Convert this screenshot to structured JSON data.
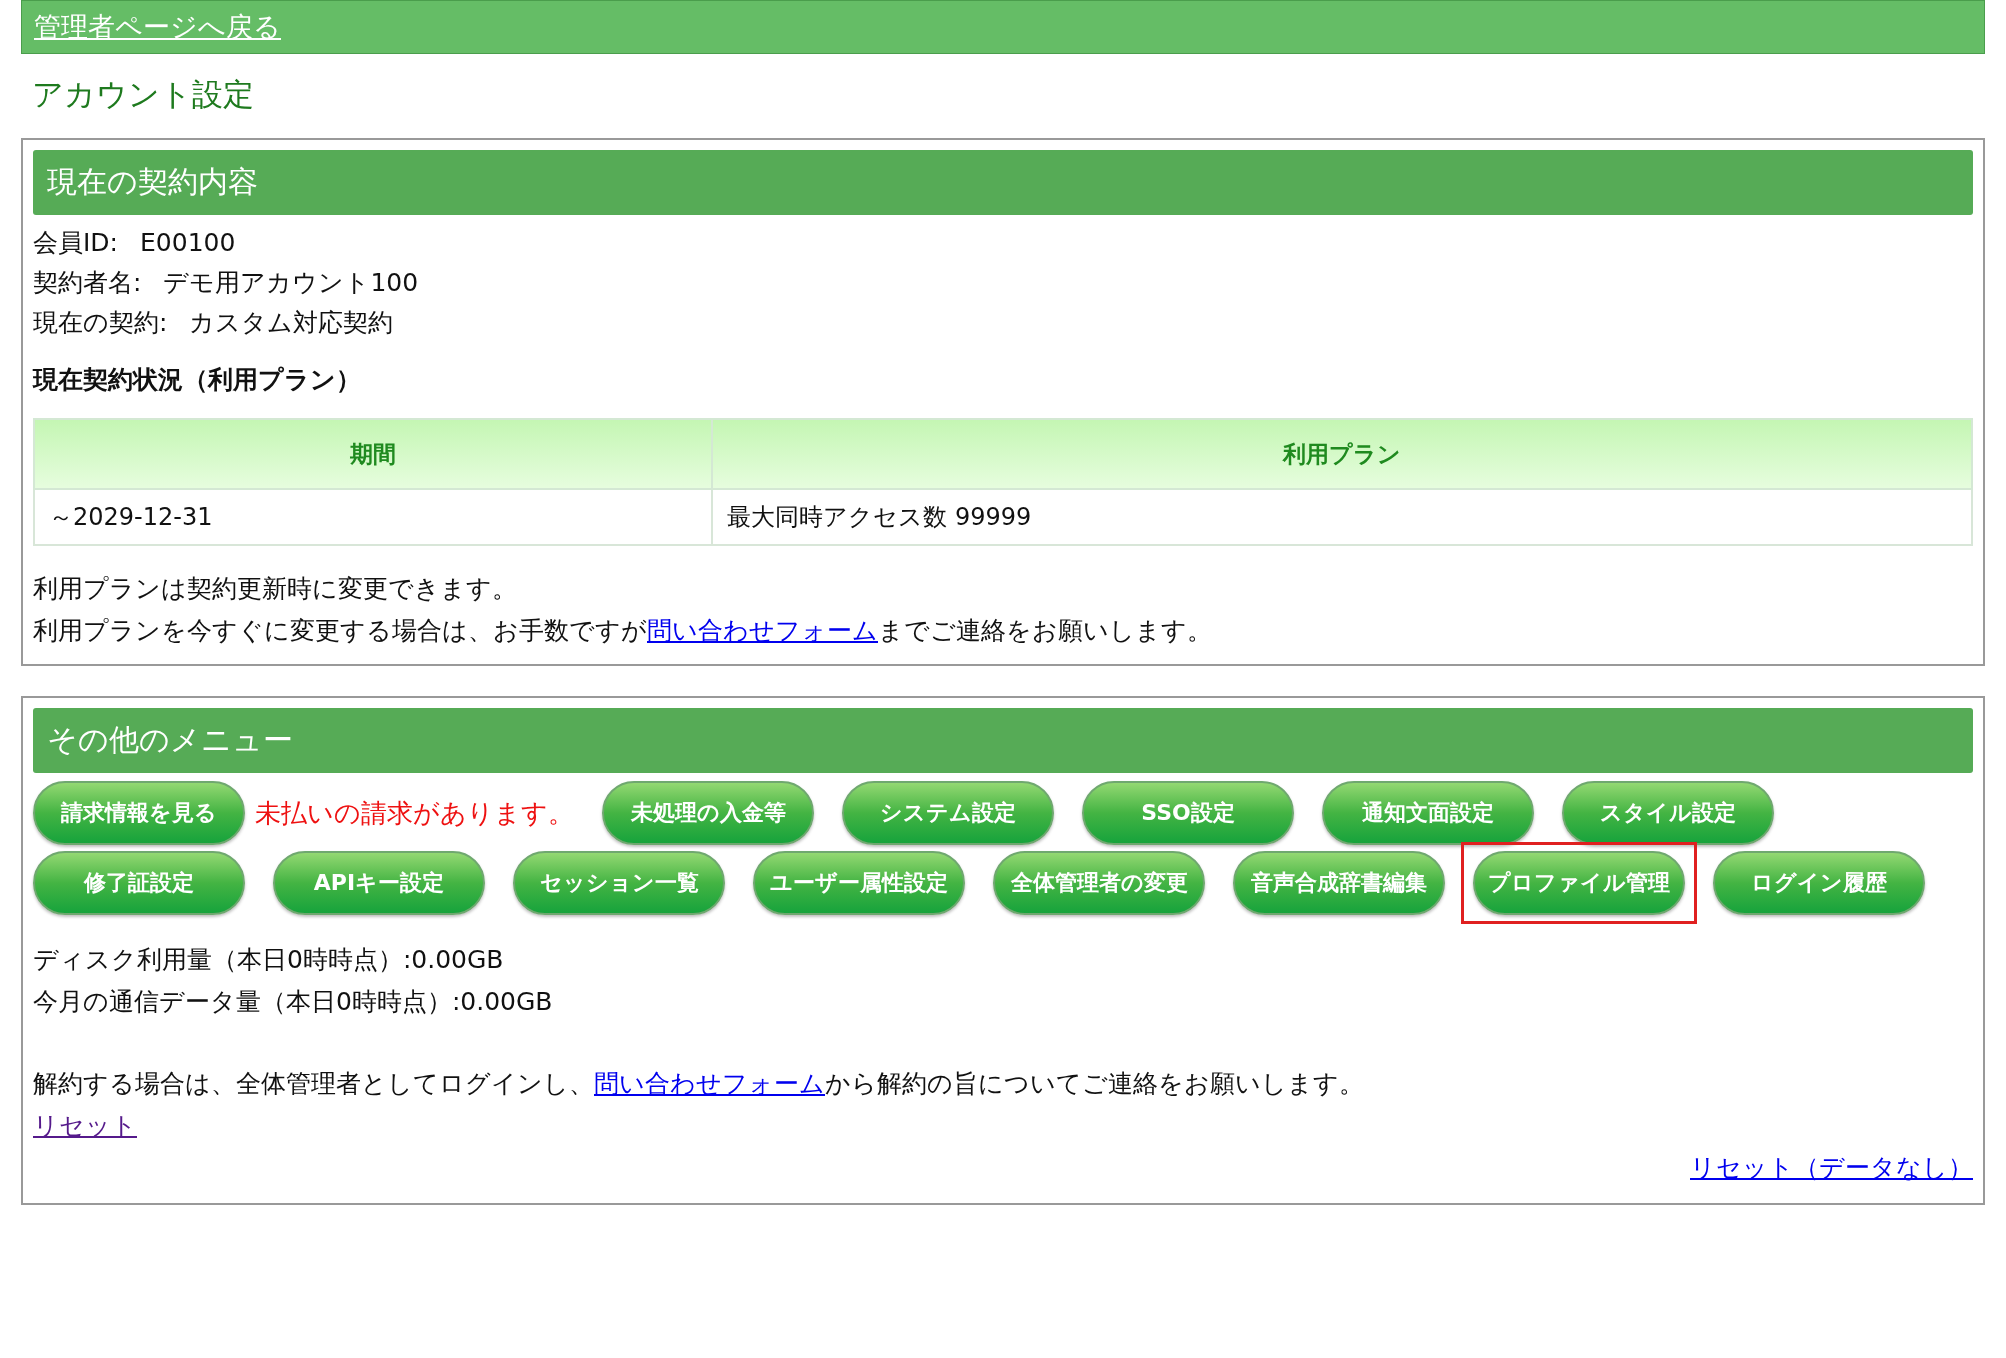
{
  "top_bar": {
    "back_link": "管理者ページへ戻る"
  },
  "page_title": "アカウント設定",
  "contract_panel": {
    "heading": "現在の契約内容",
    "fields": [
      {
        "label": "会員ID:",
        "value": "E00100"
      },
      {
        "label": "契約者名:",
        "value": "デモ用アカウント100"
      },
      {
        "label": "現在の契約:",
        "value": "カスタム対応契約"
      }
    ],
    "status_heading": "現在契約状況（利用プラン）",
    "table": {
      "columns": [
        "期間",
        "利用プラン"
      ],
      "rows": [
        [
          "～2029-12-31",
          "最大同時アクセス数 99999"
        ]
      ]
    },
    "note": "利用プランは契約更新時に変更できます。",
    "change_note": {
      "before": "利用プランを今すぐに変更する場合は、お手数ですが",
      "link": "問い合わせフォーム",
      "after": "までご連絡をお願いします。"
    }
  },
  "menu_panel": {
    "heading": "その他のメニュー",
    "items": [
      {
        "kind": "button",
        "label": "請求情報を見る",
        "highlighted": false
      },
      {
        "kind": "notice",
        "label": "未払いの請求があります。"
      },
      {
        "kind": "button",
        "label": "未処理の入金等",
        "highlighted": false
      },
      {
        "kind": "button",
        "label": "システム設定",
        "highlighted": false
      },
      {
        "kind": "button",
        "label": "SSO設定",
        "highlighted": false
      },
      {
        "kind": "button",
        "label": "通知文面設定",
        "highlighted": false
      },
      {
        "kind": "button",
        "label": "スタイル設定",
        "highlighted": false
      },
      {
        "kind": "button",
        "label": "修了証設定",
        "highlighted": false
      },
      {
        "kind": "button",
        "label": "APIキー設定",
        "highlighted": false
      },
      {
        "kind": "button",
        "label": "セッション一覧",
        "highlighted": false
      },
      {
        "kind": "button",
        "label": "ユーザー属性設定",
        "highlighted": false
      },
      {
        "kind": "button",
        "label": "全体管理者の変更",
        "highlighted": false
      },
      {
        "kind": "button",
        "label": "音声合成辞書編集",
        "highlighted": false
      },
      {
        "kind": "button",
        "label": "プロファイル管理",
        "highlighted": true
      },
      {
        "kind": "button",
        "label": "ログイン履歴",
        "highlighted": false
      }
    ],
    "usage": [
      "ディスク利用量（本日0時時点）:0.00GB",
      "今月の通信データ量（本日0時時点）:0.00GB"
    ],
    "cancel_note": {
      "before": "解約する場合は、全体管理者としてログインし、",
      "link": "問い合わせフォーム",
      "after": "から解約の旨についてご連絡をお願いします。"
    },
    "reset_link": {
      "label": "リセット",
      "visited": true
    },
    "reset_no_data_link": {
      "label": "リセット（データなし）",
      "visited": false
    }
  }
}
